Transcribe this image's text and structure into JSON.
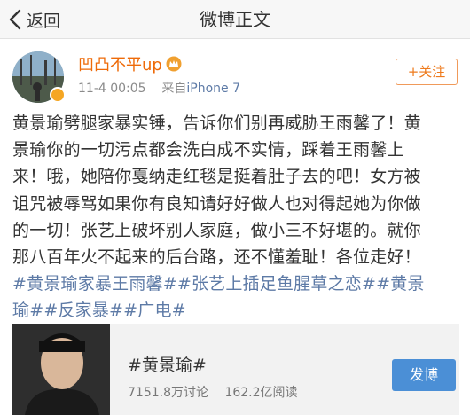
{
  "navbar": {
    "back_label": "返回",
    "title": "微博正文"
  },
  "post": {
    "username": "凹凸不平up",
    "time": "11-4 00:05",
    "source_prefix": "来自",
    "device": "iPhone 7",
    "follow_label": "+关注",
    "lines": [
      "黄景瑜劈腿家暴实锤，告诉你们别再威胁王雨馨了！黄",
      "景瑜你的一切污点都会洗白成不实情，踩着王雨馨上",
      "来！哦，她陪你戛纳走红毯是挺着肚子去的吧！女方被",
      "诅咒被辱骂如果你有良知请好好做人也对得起她为你做",
      "的一切！张艺上破坏别人家庭，做小三不好堪的。就你",
      "那八百年火不起来的后台路，还不懂羞耻！各位走好！"
    ],
    "hashtag_line1": "#黄景瑜家暴王雨馨##张艺上插足鱼腥草之恋##黄景",
    "hashtag_line2": "瑜##反家暴##广电#"
  },
  "topic_card": {
    "title": "#黄景瑜#",
    "discussions": "7151.8万讨论",
    "reads": "162.2亿阅读",
    "button_label": "发博"
  },
  "colors": {
    "username": "#ee6a08",
    "link": "#5d7aa6",
    "follow": "#ee7a1c",
    "post_button": "#4b8fd6"
  },
  "icons": [
    "back-chevron-icon",
    "level-crown-icon",
    "verified-badge-icon"
  ]
}
